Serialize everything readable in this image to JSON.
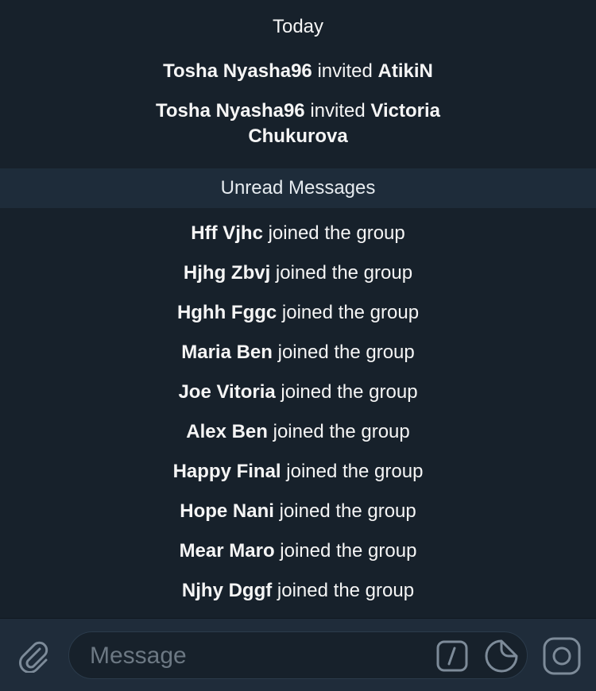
{
  "chat": {
    "date_header": "Today",
    "invites": [
      {
        "inviter": "Tosha Nyasha96",
        "verb": "invited",
        "invitee": "AtikiN"
      },
      {
        "inviter": "Tosha Nyasha96",
        "verb": "invited",
        "invitee": "Victoria Chukurova"
      }
    ],
    "unread_label": "Unread Messages",
    "join_suffix": "joined the group",
    "joins": [
      {
        "name": "Hff Vjhc"
      },
      {
        "name": "Hjhg Zbvj"
      },
      {
        "name": "Hghh Fggc"
      },
      {
        "name": "Maria Ben"
      },
      {
        "name": "Joe Vitoria"
      },
      {
        "name": "Alex Ben"
      },
      {
        "name": "Happy Final"
      },
      {
        "name": "Hope Nani"
      },
      {
        "name": "Mear Maro"
      },
      {
        "name": "Njhy Dggf"
      }
    ]
  },
  "composer": {
    "placeholder": "Message",
    "icons": {
      "attach": "paperclip-icon",
      "commands": "slash-command-icon",
      "sticker": "sticker-icon",
      "camera": "camera-icon"
    }
  },
  "colors": {
    "background": "#17212b",
    "unread_bar": "#1e2c3a",
    "input_bar": "#1f2c3a",
    "icon": "#7d8b99"
  }
}
